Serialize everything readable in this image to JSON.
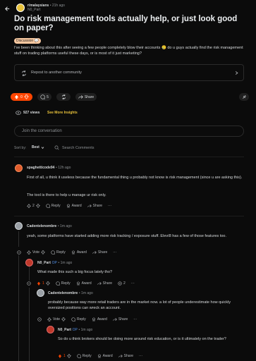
{
  "header": {
    "back_icon": "arrow-left-icon",
    "subreddit": "r/malaysians",
    "dot": "•",
    "time": "21h ago",
    "user": "N0_Part"
  },
  "post": {
    "title": "Do risk management tools actually help, or just look good on paper?",
    "flair": "Discussion 💬",
    "body": "I've been thinking about this after seeing a few people completely blow their accounts 🥲 do u guys actually find the risk management stuff on trading platforms useful these days, or is most of it just marketing?",
    "repost_label": "Repost to another community",
    "votes": "0",
    "comments": "5",
    "share_label": "Share",
    "views": "927 views",
    "insights_label": "See More Insights"
  },
  "conversation": {
    "placeholder": "Join the conversation",
    "sort_label": "Sort by:",
    "sort_value": "Best",
    "search_label": "Search Comments"
  },
  "comments": [
    {
      "author": "spaghetticode94",
      "time": "• 12h ago",
      "paragraphs": [
        "First of all, u think it useless because the fundamental thing u probably not know is risk management (since u are asking this).",
        "The tool is there to help u manage ur risk only."
      ],
      "votes": "2",
      "reply_label": "Reply",
      "award_label": "Award",
      "share_label": "Share",
      "more_label": "···"
    },
    {
      "author": "Cadentelenombre",
      "time": "• 1m ago",
      "text": "yeah, some platforms have started adding more risk tracking / exposure stuff. Eleví8 has a few of those features too.",
      "vote_label": "Vote",
      "reply_label": "Reply",
      "award_label": "Award",
      "share_label": "Share",
      "more_label": "···"
    },
    {
      "author": "N0_Part",
      "op": "OP",
      "time": "• 1m ago",
      "text": "What made this such a big focus lately tho?",
      "votes": "1",
      "reply_label": "Reply",
      "award_label": "Award",
      "share_label": "Share",
      "replies_count": "2",
      "more_label": "···"
    },
    {
      "author": "Cadentelenombre",
      "time": "• 1m ago",
      "text": "probably because way more retail traders are in the market now. a lot of people underestimate how quickly oversized positions can wreck an account.",
      "vote_label": "Vote",
      "reply_label": "Reply",
      "award_label": "Award",
      "share_label": "Share",
      "more_label": "···"
    },
    {
      "author": "N0_Part",
      "op": "OP",
      "time": "• 1m ago",
      "text": "So do u think brokers should be doing more around risk education, or is it ultimately on the trader?",
      "votes": "1",
      "reply_label": "Reply",
      "award_label": "Award",
      "share_label": "Share",
      "more_label": "···"
    }
  ],
  "colors": {
    "background": "#0b0b0b",
    "upvote_active": "#ff4500",
    "link_blue": "#4f8fe8",
    "flair_bg": "#f7c8a0"
  }
}
